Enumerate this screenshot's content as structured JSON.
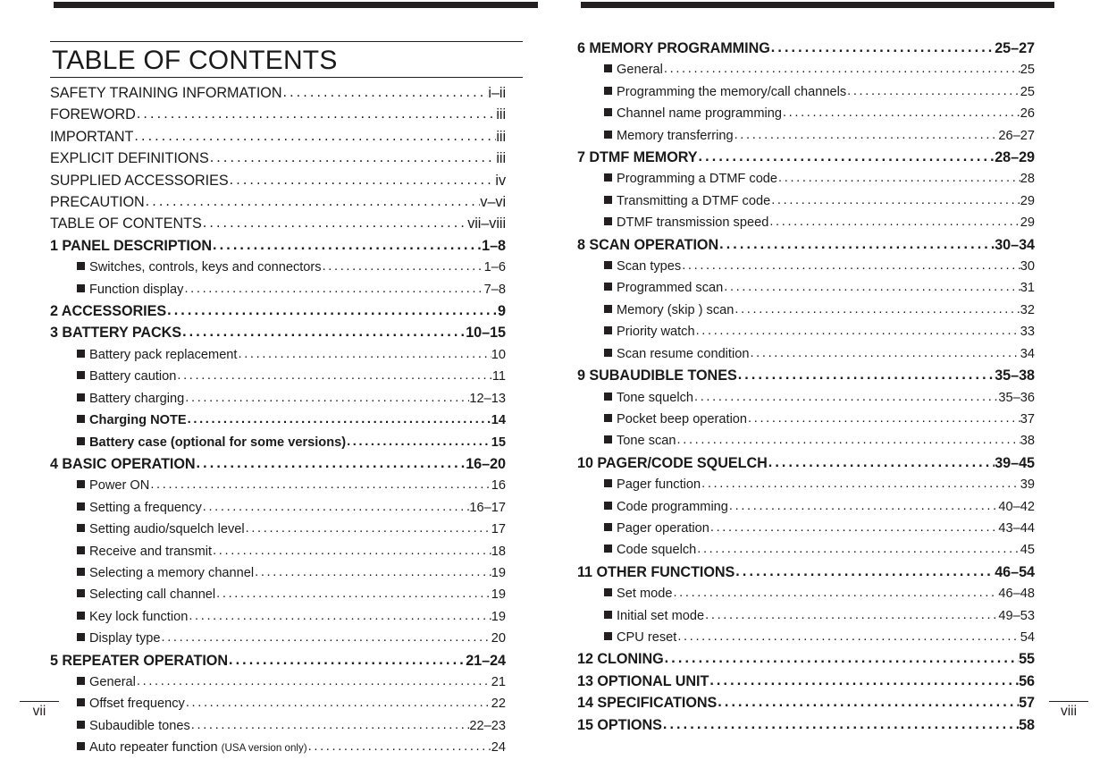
{
  "document": {
    "title": "TABLE OF CONTENTS"
  },
  "left_page": {
    "folio": "vii",
    "entries": [
      {
        "level": 0,
        "label": "SAFETY TRAINING INFORMATION",
        "page": "i–ii"
      },
      {
        "level": 0,
        "label": "FOREWORD",
        "page": "iii"
      },
      {
        "level": 0,
        "label": "IMPORTANT",
        "page": "iii"
      },
      {
        "level": 0,
        "label": "EXPLICIT DEFINITIONS",
        "page": "iii"
      },
      {
        "level": 0,
        "label": "SUPPLIED ACCESSORIES",
        "page": "iv"
      },
      {
        "level": 0,
        "label": "PRECAUTION",
        "page": "v–vi"
      },
      {
        "level": 0,
        "label": "TABLE OF CONTENTS",
        "page": "vii–viii"
      },
      {
        "level": 1,
        "label": "1 PANEL DESCRIPTION",
        "page": "1–8"
      },
      {
        "level": 2,
        "label": "Switches, controls, keys and connectors",
        "page": "1–6"
      },
      {
        "level": 2,
        "label": "Function display",
        "page": "7–8"
      },
      {
        "level": 1,
        "label": "2 ACCESSORIES",
        "page": "9"
      },
      {
        "level": 1,
        "label": "3 BATTERY PACKS",
        "page": "10–15"
      },
      {
        "level": 2,
        "label": "Battery pack replacement",
        "page": "10"
      },
      {
        "level": 2,
        "label": "Battery caution",
        "page": "11"
      },
      {
        "level": 2,
        "label": "Battery charging",
        "page": "12–13"
      },
      {
        "level": 2,
        "label": "Charging NOTE",
        "page": "14",
        "bold": true
      },
      {
        "level": 2,
        "label": "Battery case (optional for some versions)",
        "page": "15",
        "bold": true
      },
      {
        "level": 1,
        "label": "4 BASIC OPERATION",
        "page": "16–20"
      },
      {
        "level": 2,
        "label": "Power ON",
        "page": "16"
      },
      {
        "level": 2,
        "label": "Setting a frequency",
        "page": "16–17"
      },
      {
        "level": 2,
        "label": "Setting audio/squelch level",
        "page": "17"
      },
      {
        "level": 2,
        "label": "Receive and transmit",
        "page": "18"
      },
      {
        "level": 2,
        "label": "Selecting a memory channel",
        "page": "19"
      },
      {
        "level": 2,
        "label": "Selecting call channel",
        "page": "19"
      },
      {
        "level": 2,
        "label": "Key lock function",
        "page": "19"
      },
      {
        "level": 2,
        "label": "Display type",
        "page": "20"
      },
      {
        "level": 1,
        "label": "5 REPEATER OPERATION",
        "page": "21–24"
      },
      {
        "level": 2,
        "label": "General",
        "page": "21"
      },
      {
        "level": 2,
        "label": "Offset frequency",
        "page": "22"
      },
      {
        "level": 2,
        "label": "Subaudible tones",
        "page": "22–23"
      },
      {
        "level": 2,
        "label": "Auto repeater function ",
        "small": "(USA version only)",
        "page": "24"
      }
    ]
  },
  "right_page": {
    "folio": "viii",
    "entries": [
      {
        "level": 1,
        "label": "6 MEMORY PROGRAMMING",
        "page": "25–27"
      },
      {
        "level": 2,
        "label": "General",
        "page": "25"
      },
      {
        "level": 2,
        "label": "Programming the memory/call channels",
        "page": "25"
      },
      {
        "level": 2,
        "label": "Channel name programming",
        "page": "26"
      },
      {
        "level": 2,
        "label": "Memory transferring",
        "page": "26–27"
      },
      {
        "level": 1,
        "label": "7 DTMF MEMORY",
        "page": "28–29"
      },
      {
        "level": 2,
        "label": "Programming a DTMF code",
        "page": "28"
      },
      {
        "level": 2,
        "label": "Transmitting  a DTMF code",
        "page": "29"
      },
      {
        "level": 2,
        "label": "DTMF transmission speed",
        "page": "29"
      },
      {
        "level": 1,
        "label": "8 SCAN OPERATION",
        "page": "30–34"
      },
      {
        "level": 2,
        "label": "Scan types",
        "page": "30"
      },
      {
        "level": 2,
        "label": "Programmed scan",
        "page": "31"
      },
      {
        "level": 2,
        "label": "Memory (skip ) scan",
        "page": "32"
      },
      {
        "level": 2,
        "label": "Priority watch",
        "page": "33"
      },
      {
        "level": 2,
        "label": "Scan resume condition",
        "page": "34"
      },
      {
        "level": 1,
        "label": "9 SUBAUDIBLE TONES",
        "page": "35–38"
      },
      {
        "level": 2,
        "label": "Tone squelch",
        "page": "35–36"
      },
      {
        "level": 2,
        "label": "Pocket beep operation",
        "page": "37"
      },
      {
        "level": 2,
        "label": "Tone scan",
        "page": "38"
      },
      {
        "level": 1,
        "label": "10 PAGER/CODE SQUELCH",
        "page": "39–45"
      },
      {
        "level": 2,
        "label": "Pager function",
        "page": "39"
      },
      {
        "level": 2,
        "label": "Code programming",
        "page": "40–42"
      },
      {
        "level": 2,
        "label": "Pager operation",
        "page": "43–44"
      },
      {
        "level": 2,
        "label": "Code squelch",
        "page": "45"
      },
      {
        "level": 1,
        "label": "11 OTHER FUNCTIONS",
        "page": "46–54"
      },
      {
        "level": 2,
        "label": "Set mode",
        "page": "46–48"
      },
      {
        "level": 2,
        "label": "Initial set mode",
        "page": "49–53"
      },
      {
        "level": 2,
        "label": "CPU reset",
        "page": "54"
      },
      {
        "level": 1,
        "label": "12 CLONING",
        "page": "55"
      },
      {
        "level": 1,
        "label": "13 OPTIONAL UNIT",
        "page": "56"
      },
      {
        "level": 1,
        "label": "14 SPECIFICATIONS",
        "page": "57"
      },
      {
        "level": 1,
        "label": "15 OPTIONS",
        "page": "58"
      }
    ]
  }
}
